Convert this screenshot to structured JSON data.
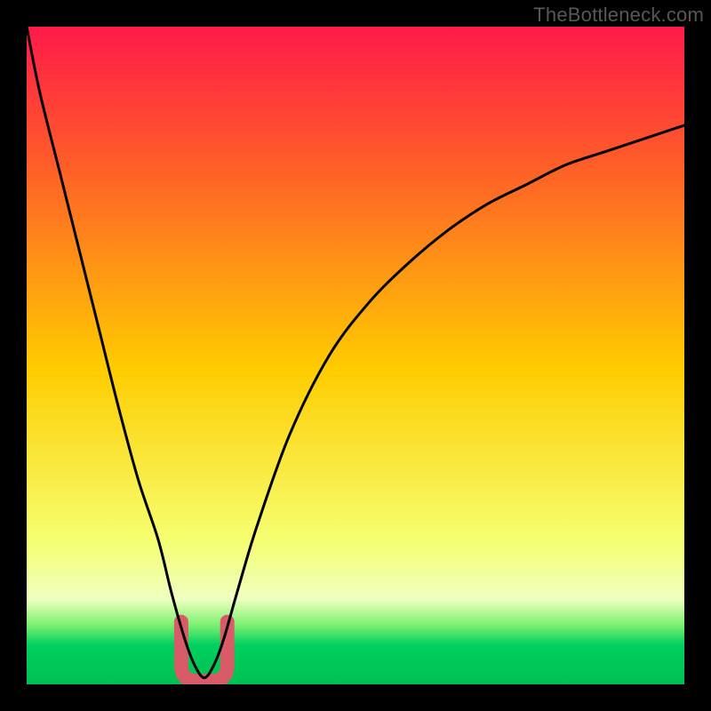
{
  "watermark": "TheBottleneck.com",
  "colors": {
    "frame": "#000000",
    "gradient_top": "#ff1a4a",
    "gradient_upper": "#ff5a2a",
    "gradient_mid": "#ffcc00",
    "gradient_lower": "#f5ff70",
    "gradient_band_light": "#f0ffc0",
    "gradient_band_green1": "#7cf070",
    "gradient_band_green2": "#00d060",
    "gradient_bottom": "#00c050",
    "curve": "#000000",
    "marker": "#d85c68"
  },
  "chart_data": {
    "type": "line",
    "title": "",
    "xlabel": "",
    "ylabel": "",
    "xlim": [
      0,
      100
    ],
    "ylim": [
      0,
      100
    ],
    "series": [
      {
        "name": "bottleneck-curve",
        "x": [
          0,
          2,
          5,
          8,
          11,
          14,
          17,
          20,
          22,
          24,
          25.5,
          27,
          28.5,
          30,
          32,
          35,
          40,
          46,
          52,
          58,
          64,
          70,
          76,
          82,
          88,
          94,
          100
        ],
        "values": [
          100,
          90,
          78,
          66,
          54,
          42,
          31,
          22,
          14,
          7,
          3,
          1,
          3,
          7,
          14,
          24,
          38,
          50,
          58,
          64,
          69,
          73,
          76,
          79,
          81,
          83,
          85
        ]
      }
    ],
    "marker_band": {
      "name": "optimal-range-marker",
      "x_start": 23.5,
      "x_end": 30.5,
      "y_top": 9.5,
      "y_bottom": 0.5
    },
    "gradient_stops_pct": [
      {
        "offset": 0,
        "color_key": "gradient_top"
      },
      {
        "offset": 20,
        "color_key": "gradient_upper"
      },
      {
        "offset": 52,
        "color_key": "gradient_mid"
      },
      {
        "offset": 78,
        "color_key": "gradient_lower"
      },
      {
        "offset": 87,
        "color_key": "gradient_band_light"
      },
      {
        "offset": 91,
        "color_key": "gradient_band_green1"
      },
      {
        "offset": 94,
        "color_key": "gradient_band_green2"
      },
      {
        "offset": 100,
        "color_key": "gradient_bottom"
      }
    ]
  }
}
